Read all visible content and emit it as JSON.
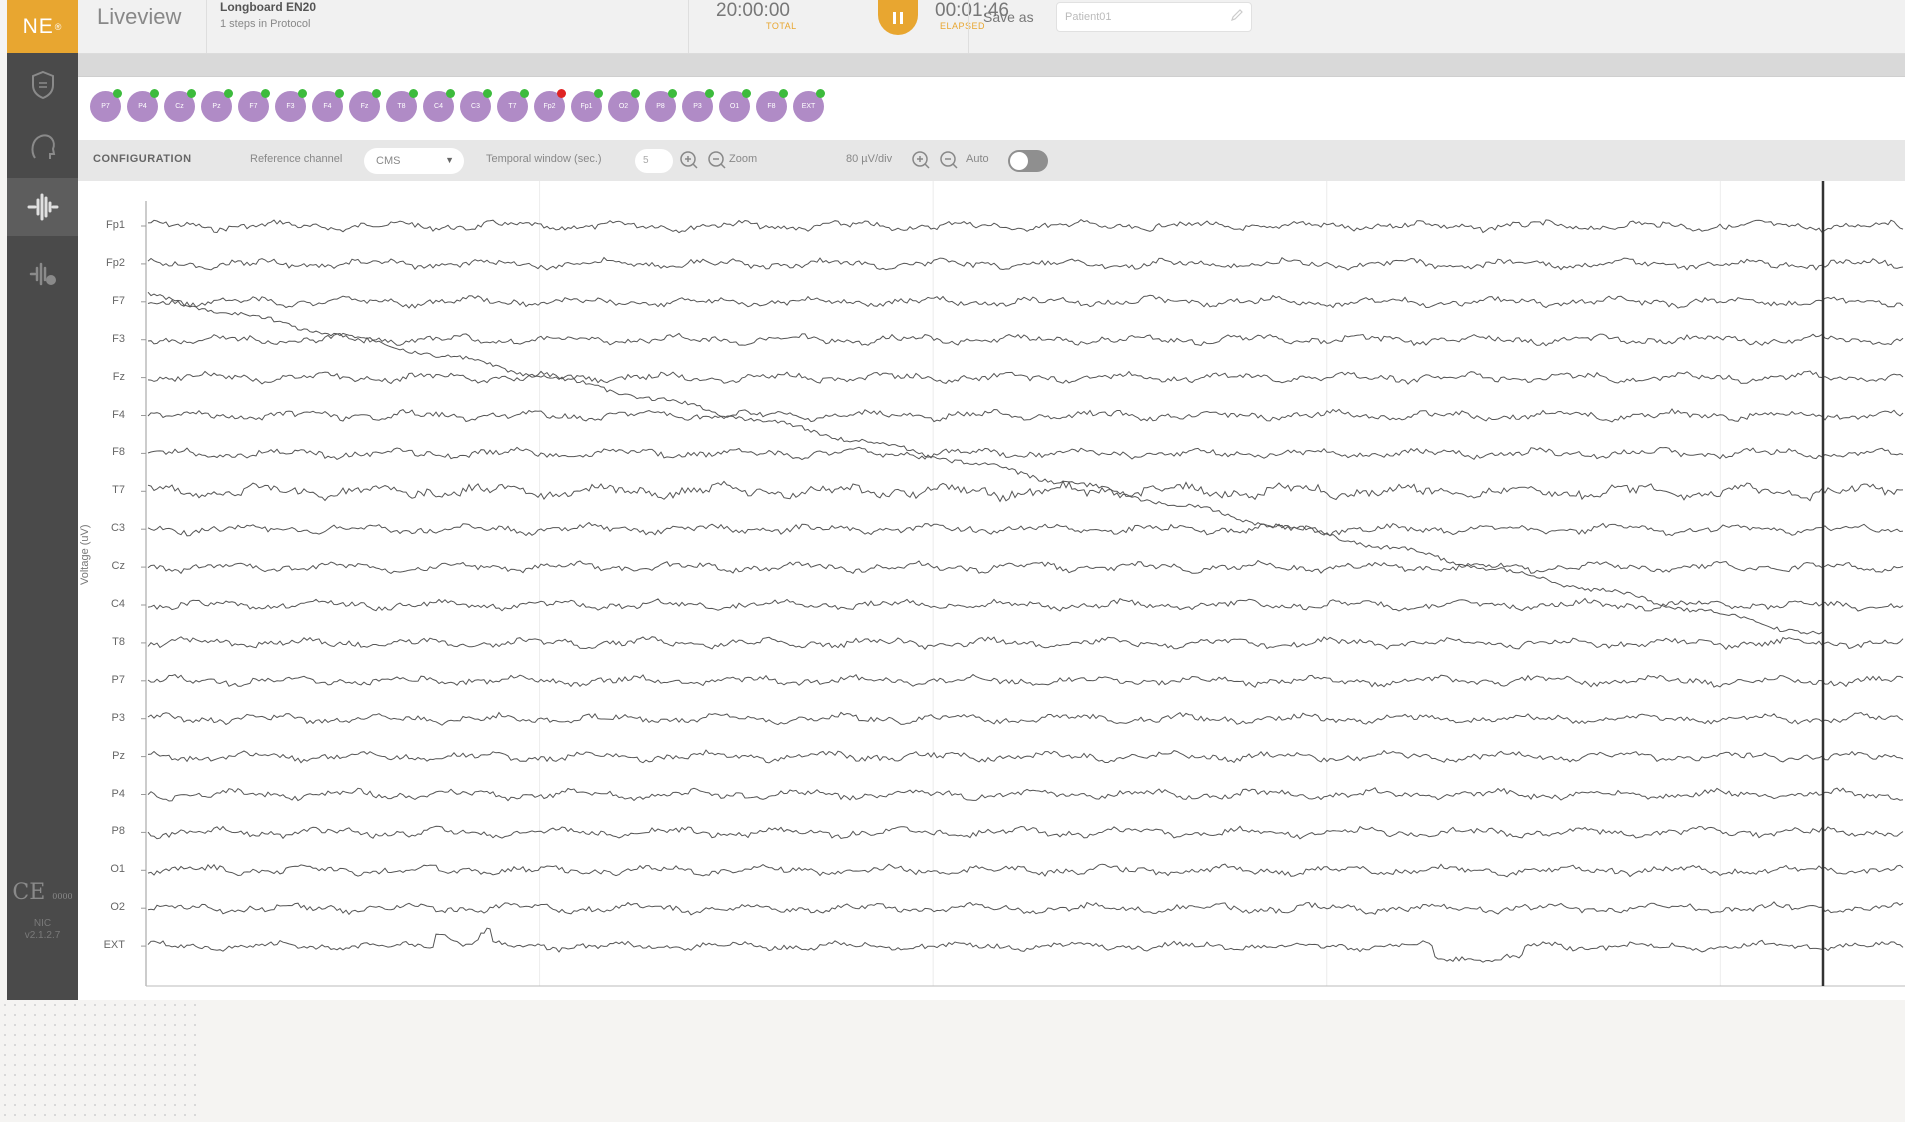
{
  "app": {
    "logo": "NE",
    "logo_mark": "®",
    "title": "Liveview"
  },
  "protocol": {
    "name": "Longboard EN20",
    "steps": "1 steps in Protocol"
  },
  "timer": {
    "total_value": "20:00:00",
    "total_label": "TOTAL",
    "elapsed_value": "00:01:46",
    "elapsed_label": "ELAPSED"
  },
  "save": {
    "label": "Save as",
    "value": "Patient01"
  },
  "sidebar": {
    "items": [
      {
        "icon": "shield-icon",
        "active": false
      },
      {
        "icon": "head-icon",
        "active": false
      },
      {
        "icon": "waveform-icon",
        "active": true
      },
      {
        "icon": "stimulation-icon",
        "active": false
      }
    ],
    "ce": "CE",
    "ce_sub": "0000",
    "version_1": "NIC",
    "version_2": "v2.1.2.7"
  },
  "electrodes": [
    {
      "label": "P7",
      "status": "green"
    },
    {
      "label": "P4",
      "status": "green"
    },
    {
      "label": "Cz",
      "status": "green"
    },
    {
      "label": "Pz",
      "status": "green"
    },
    {
      "label": "F7",
      "status": "green"
    },
    {
      "label": "F3",
      "status": "green"
    },
    {
      "label": "F4",
      "status": "green"
    },
    {
      "label": "Fz",
      "status": "green"
    },
    {
      "label": "T8",
      "status": "green"
    },
    {
      "label": "C4",
      "status": "green"
    },
    {
      "label": "C3",
      "status": "green"
    },
    {
      "label": "T7",
      "status": "green"
    },
    {
      "label": "Fp2",
      "status": "red"
    },
    {
      "label": "Fp1",
      "status": "green"
    },
    {
      "label": "O2",
      "status": "green"
    },
    {
      "label": "P8",
      "status": "green"
    },
    {
      "label": "P3",
      "status": "green"
    },
    {
      "label": "O1",
      "status": "green"
    },
    {
      "label": "F8",
      "status": "green"
    },
    {
      "label": "EXT",
      "status": "green"
    }
  ],
  "config": {
    "title": "CONFIGURATION",
    "reference_label": "Reference channel",
    "reference_value": "CMS",
    "temporal_label": "Temporal window (sec.)",
    "temporal_value": "5",
    "zoom_label": "Zoom",
    "scale_label": "80 µV/div",
    "auto_label": "Auto"
  },
  "plot": {
    "ylabel": "Voltage (uV)",
    "channels": [
      "Fp1",
      "Fp2",
      "F7",
      "F3",
      "Fz",
      "F4",
      "F8",
      "T7",
      "C3",
      "Cz",
      "C4",
      "T8",
      "P7",
      "P3",
      "Pz",
      "P4",
      "P8",
      "O1",
      "O2",
      "EXT"
    ]
  },
  "colors": {
    "accent": "#e8a630",
    "sidebar": "#4a4a4a",
    "electrode": "#b08bc6",
    "status_ok": "#3dbb3d",
    "status_bad": "#e02424",
    "trace": "#555555"
  }
}
